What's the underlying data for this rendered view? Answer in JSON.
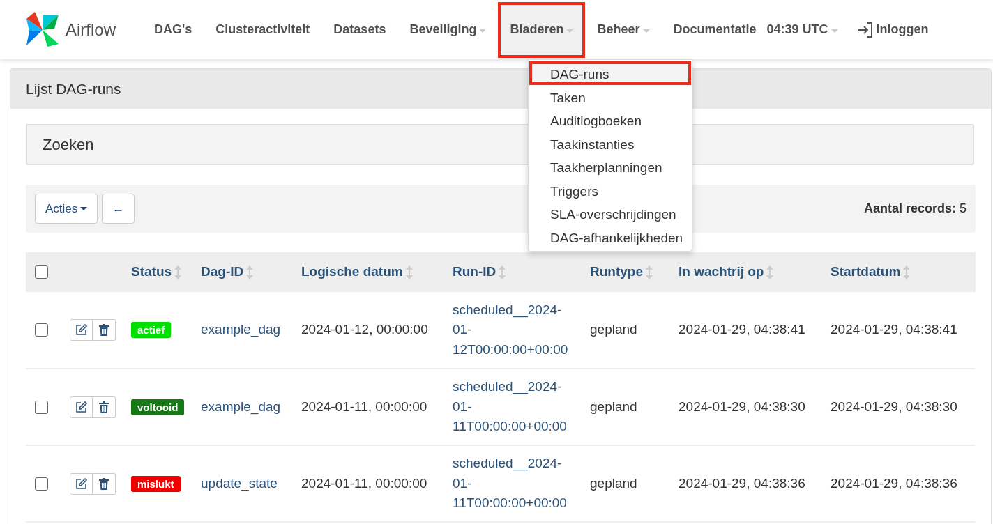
{
  "brand": "Airflow",
  "nav": [
    {
      "label": "DAG's",
      "dropdown": false,
      "highlighted": false
    },
    {
      "label": "Clusteractiviteit",
      "dropdown": false,
      "highlighted": false
    },
    {
      "label": "Datasets",
      "dropdown": false,
      "highlighted": false
    },
    {
      "label": "Beveiliging",
      "dropdown": true,
      "highlighted": false
    },
    {
      "label": "Bladeren",
      "dropdown": true,
      "highlighted": true
    },
    {
      "label": "Beheer",
      "dropdown": true,
      "highlighted": false
    },
    {
      "label": "Documentatie",
      "dropdown": false,
      "highlighted": false
    }
  ],
  "clock": "04:39 UTC",
  "login": "Inloggen",
  "menu": [
    {
      "label": "DAG-runs",
      "highlighted": true
    },
    {
      "label": "Taken",
      "highlighted": false
    },
    {
      "label": "Auditlogboeken",
      "highlighted": false
    },
    {
      "label": "Taakinstanties",
      "highlighted": false
    },
    {
      "label": "Taakherplanningen",
      "highlighted": false
    },
    {
      "label": "Triggers",
      "highlighted": false
    },
    {
      "label": "SLA-overschrijdingen",
      "highlighted": false
    },
    {
      "label": "DAG-afhankelijkheden",
      "highlighted": false
    }
  ],
  "panel_title": "Lijst DAG-runs",
  "search_title": "Zoeken",
  "actions_button": "Acties",
  "back_button": "←",
  "record_count": {
    "label": "Aantal records:",
    "value": "5"
  },
  "table": {
    "select_all_checked": false,
    "columns": [
      "Status",
      "Dag-ID",
      "Logische datum",
      "Run-ID",
      "Runtype",
      "In wachtrij op",
      "Startdatum"
    ],
    "rows": [
      {
        "checked": false,
        "status": "actief",
        "color": "#00e000",
        "dag_id": "example_dag",
        "logical_date": "2024-01-12, 00:00:00",
        "run_id": "scheduled__2024-01-12T00:00:00+00:00",
        "run_type": "gepland",
        "queued_at": "2024-01-29, 04:38:41",
        "start_date": "2024-01-29, 04:38:41"
      },
      {
        "checked": false,
        "status": "voltooid",
        "color": "#157a15",
        "dag_id": "example_dag",
        "logical_date": "2024-01-11, 00:00:00",
        "run_id": "scheduled__2024-01-11T00:00:00+00:00",
        "run_type": "gepland",
        "queued_at": "2024-01-29, 04:38:30",
        "start_date": "2024-01-29, 04:38:30"
      },
      {
        "checked": false,
        "status": "mislukt",
        "color": "#f00000",
        "dag_id": "update_state",
        "logical_date": "2024-01-11, 00:00:00",
        "run_id": "scheduled__2024-01-11T00:00:00+00:00",
        "run_type": "gepland",
        "queued_at": "2024-01-29, 04:38:36",
        "start_date": "2024-01-29, 04:38:36"
      }
    ]
  }
}
